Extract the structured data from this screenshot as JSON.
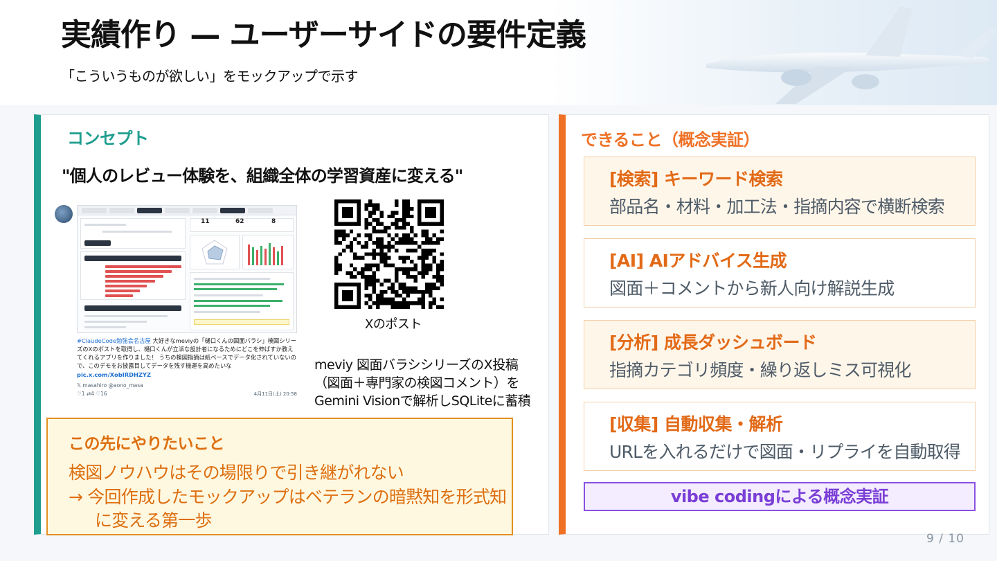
{
  "header": {
    "title": "実績作り — ユーザーサイドの要件定義",
    "subtitle": "「こういうものが欲しい」をモックアップで示す"
  },
  "concept": {
    "heading": "コンセプト",
    "quote": "\"個人のレビュー体験を、組織全体の学習資産に変える\"",
    "qr_caption": "Xのポスト",
    "description": [
      "meviy 図面バラシシリーズのX投稿",
      "（図面＋専門家の検図コメント）を",
      "Gemini Visionで解析しSQLiteに蓄積"
    ],
    "post": {
      "hashtag": "#ClaudeCode勉強会名古屋",
      "text": " 大好きなmeviyの「樋口くんの図面バラシ」検図シリーズのXのポストを取得し、樋口くんが立派な設計者になるためにどこを伸ばすか教えてくれるアプリを作りました！ うちの検図指摘は紙ベースでデータ化されていないので、このデモをお披露目してデータを残す機運を高めたいな",
      "link": "pic.x.com/XobIRDHZYZ",
      "user": "𝕏 masahiro @aono_masa",
      "meta": "♡1   ⇄4   ♡16",
      "date": "4月11日(土) 20:58",
      "stats": [
        "11",
        "62",
        "8"
      ]
    }
  },
  "future": {
    "heading": "この先にやりたいこと",
    "line1": "検図ノウハウはその場限りで引き継がれない",
    "line2": "→ 今回作成したモックアップはベテランの暗黙知を形式知",
    "line3": "に変える第一歩"
  },
  "capabilities": {
    "heading": "できること（概念実証）",
    "items": [
      {
        "title": "[検索] キーワード検索",
        "desc": "部品名・材料・加工法・指摘内容で横断検索"
      },
      {
        "title": "[AI] AIアドバイス生成",
        "desc": "図面＋コメントから新人向け解説生成"
      },
      {
        "title": "[分析] 成長ダッシュボード",
        "desc": "指摘カテゴリ頻度・繰り返しミス可視化"
      },
      {
        "title": "[収集] 自動収集・解析",
        "desc": "URLを入れるだけで図面・リプライを自動取得"
      }
    ],
    "banner": "vibe codingによる概念実証"
  },
  "page_number": "9 / 10",
  "colors": {
    "teal": "#1f9e8f",
    "orange": "#ef7126",
    "purple": "#7a3ed6"
  }
}
